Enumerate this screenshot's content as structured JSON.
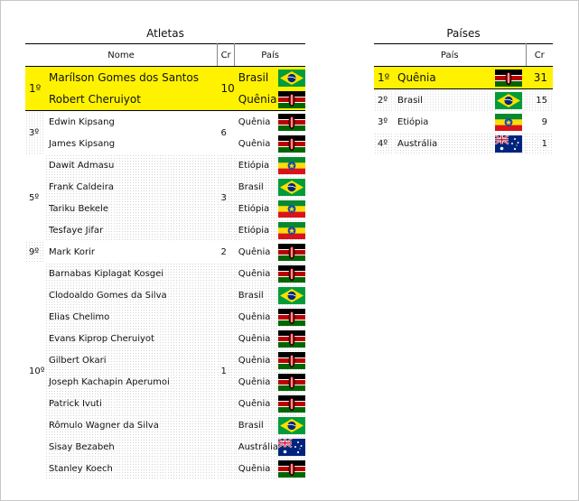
{
  "athletes": {
    "title": "Atletas",
    "headers": {
      "name": "Nome",
      "cr": "Cr",
      "country": "País"
    },
    "groups": [
      {
        "rank": "1º",
        "cr": "10",
        "highlight": true,
        "rows": [
          {
            "name": "Marílson Gomes dos Santos",
            "country": "Brasil",
            "flag": "flag-brazil-icon"
          },
          {
            "name": "Robert Cheruiyot",
            "country": "Quênia",
            "flag": "flag-kenya-icon"
          }
        ]
      },
      {
        "rank": "3º",
        "cr": "6",
        "rows": [
          {
            "name": "Edwin Kipsang",
            "country": "Quênia",
            "flag": "flag-kenya-icon"
          },
          {
            "name": "James Kipsang",
            "country": "Quênia",
            "flag": "flag-kenya-icon"
          }
        ]
      },
      {
        "rank": "5º",
        "cr": "3",
        "rows": [
          {
            "name": "Dawit Admasu",
            "country": "Etiópia",
            "flag": "flag-ethiopia-icon"
          },
          {
            "name": "Frank Caldeira",
            "country": "Brasil",
            "flag": "flag-brazil-icon"
          },
          {
            "name": "Tariku Bekele",
            "country": "Etiópia",
            "flag": "flag-ethiopia-icon"
          },
          {
            "name": "Tesfaye Jifar",
            "country": "Etiópia",
            "flag": "flag-ethiopia-icon"
          }
        ]
      },
      {
        "rank": "9º",
        "cr": "2",
        "rows": [
          {
            "name": "Mark Korir",
            "country": "Quênia",
            "flag": "flag-kenya-icon"
          }
        ]
      },
      {
        "rank": "10º",
        "cr": "1",
        "rows": [
          {
            "name": "Barnabas Kiplagat Kosgei",
            "country": "Quênia",
            "flag": "flag-kenya-icon"
          },
          {
            "name": "Clodoaldo Gomes da Silva",
            "country": "Brasil",
            "flag": "flag-brazil-icon"
          },
          {
            "name": "Elias Chelimo",
            "country": "Quênia",
            "flag": "flag-kenya-icon"
          },
          {
            "name": "Evans Kiprop Cheruiyot",
            "country": "Quênia",
            "flag": "flag-kenya-icon"
          },
          {
            "name": "Gilbert Okari",
            "country": "Quênia",
            "flag": "flag-kenya-icon"
          },
          {
            "name": "Joseph Kachapin Aperumoi",
            "country": "Quênia",
            "flag": "flag-kenya-icon"
          },
          {
            "name": "Patrick Ivuti",
            "country": "Quênia",
            "flag": "flag-kenya-icon"
          },
          {
            "name": "Rômulo Wagner da Silva",
            "country": "Brasil",
            "flag": "flag-brazil-icon"
          },
          {
            "name": "Sisay Bezabeh",
            "country": "Austrália",
            "flag": "flag-australia-icon"
          },
          {
            "name": "Stanley Koech",
            "country": "Quênia",
            "flag": "flag-kenya-icon"
          }
        ]
      }
    ]
  },
  "countries": {
    "title": "Países",
    "headers": {
      "country": "País",
      "cr": "Cr"
    },
    "rows": [
      {
        "rank": "1º",
        "country": "Quênia",
        "flag": "flag-kenya-icon",
        "cr": "31",
        "highlight": true
      },
      {
        "rank": "2º",
        "country": "Brasil",
        "flag": "flag-brazil-icon",
        "cr": "15"
      },
      {
        "rank": "3º",
        "country": "Etiópia",
        "flag": "flag-ethiopia-icon",
        "cr": "9"
      },
      {
        "rank": "4º",
        "country": "Austrália",
        "flag": "flag-australia-icon",
        "cr": "1"
      }
    ]
  },
  "colors": {
    "highlight": "#fff200",
    "kenya_red": "#bb0000",
    "brazil_green": "#009c3b",
    "brazil_yellow": "#ffdf00",
    "brazil_blue": "#002776",
    "ethiopia_green": "#078930",
    "ethiopia_yellow": "#fcdd09",
    "ethiopia_red": "#da121a",
    "australia_blue": "#00247d"
  }
}
